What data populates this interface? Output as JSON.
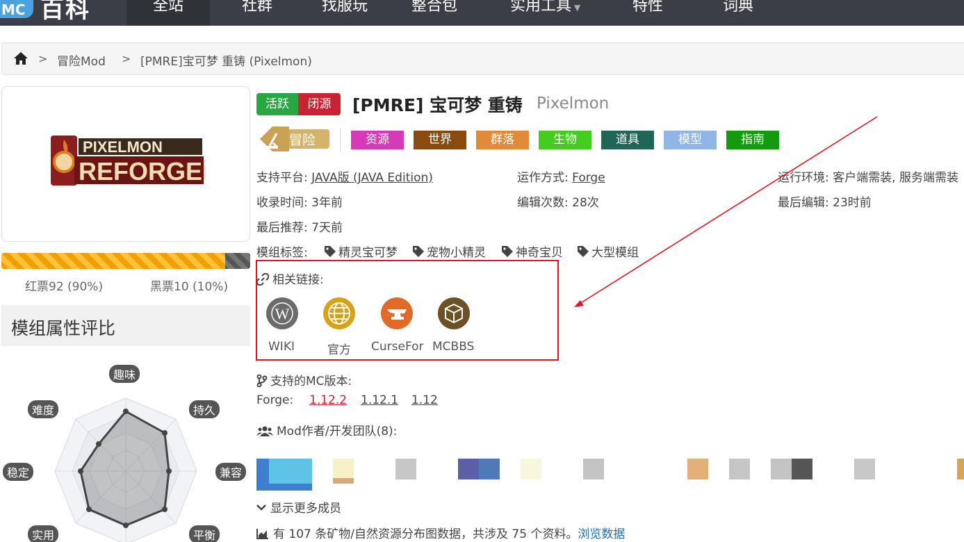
{
  "nav": {
    "logo_badge": "MC",
    "logo_text": "百科",
    "items": [
      "全站",
      "社群",
      "找服玩",
      "整合包",
      "实用工具",
      "特性",
      "词典"
    ]
  },
  "breadcrumb": {
    "sep": ">",
    "items": [
      "冒险Mod",
      "[PMRE]宝可梦 重铸 (Pixelmon)"
    ]
  },
  "votes": {
    "red_label": "红票92 (90%)",
    "black_label": "黑票10 (10%)",
    "red_fraction": 0.9
  },
  "attr": {
    "title": "模组属性评比",
    "labels": [
      "趣味",
      "持久",
      "兼容",
      "平衡",
      "实用",
      "稳定",
      "难度"
    ]
  },
  "status": {
    "active": "活跃",
    "closed": "闭源"
  },
  "title": {
    "main": "[PMRE] 宝可梦 重铸",
    "sub": "Pixelmon"
  },
  "categories": {
    "primary": "冒险",
    "items": [
      {
        "label": "资源",
        "color": "#d63ab8"
      },
      {
        "label": "世界",
        "color": "#8b4a10"
      },
      {
        "label": "群落",
        "color": "#e08a3a"
      },
      {
        "label": "生物",
        "color": "#44cc1f"
      },
      {
        "label": "道具",
        "color": "#1f6656"
      },
      {
        "label": "模型",
        "color": "#8fb6e6"
      },
      {
        "label": "指南",
        "color": "#139a0f"
      }
    ]
  },
  "info": {
    "platform_label": "支持平台: ",
    "platform_value": "JAVA版 (JAVA Edition)",
    "method_label": "运作方式: ",
    "method_value": "Forge",
    "env_label": "运行环境: ",
    "env_value": "客户端需装, 服务端需装",
    "recorded": "收录时间: 3年前",
    "edits": "编辑次数: 28次",
    "last_edit": "最后编辑: 23时前",
    "last_rec": "最后推荐: 7天前",
    "tags_label": "模组标签:",
    "tags": [
      "精灵宝可梦",
      "宠物小精灵",
      "神奇宝贝",
      "大型模组"
    ]
  },
  "links": {
    "title": "相关链接:",
    "items": [
      {
        "label": "WIKI",
        "color": "#6b6b6b"
      },
      {
        "label": "官方",
        "color": "#d4a31a"
      },
      {
        "label": "CurseFor",
        "color": "#e06a2a"
      },
      {
        "label": "MCBBS",
        "color": "#6b5124"
      }
    ]
  },
  "versions": {
    "title": "支持的MC版本:",
    "loader": "Forge:",
    "list": [
      "1.12.2",
      "1.12.1",
      "1.12"
    ]
  },
  "authors": {
    "title": "Mod作者/开发团队(8):"
  },
  "show_more": "显示更多成员",
  "resources": {
    "text": "有 107 条矿物/自然资源分布图数据，共涉及 75 个资料。",
    "link": "浏览数据"
  }
}
